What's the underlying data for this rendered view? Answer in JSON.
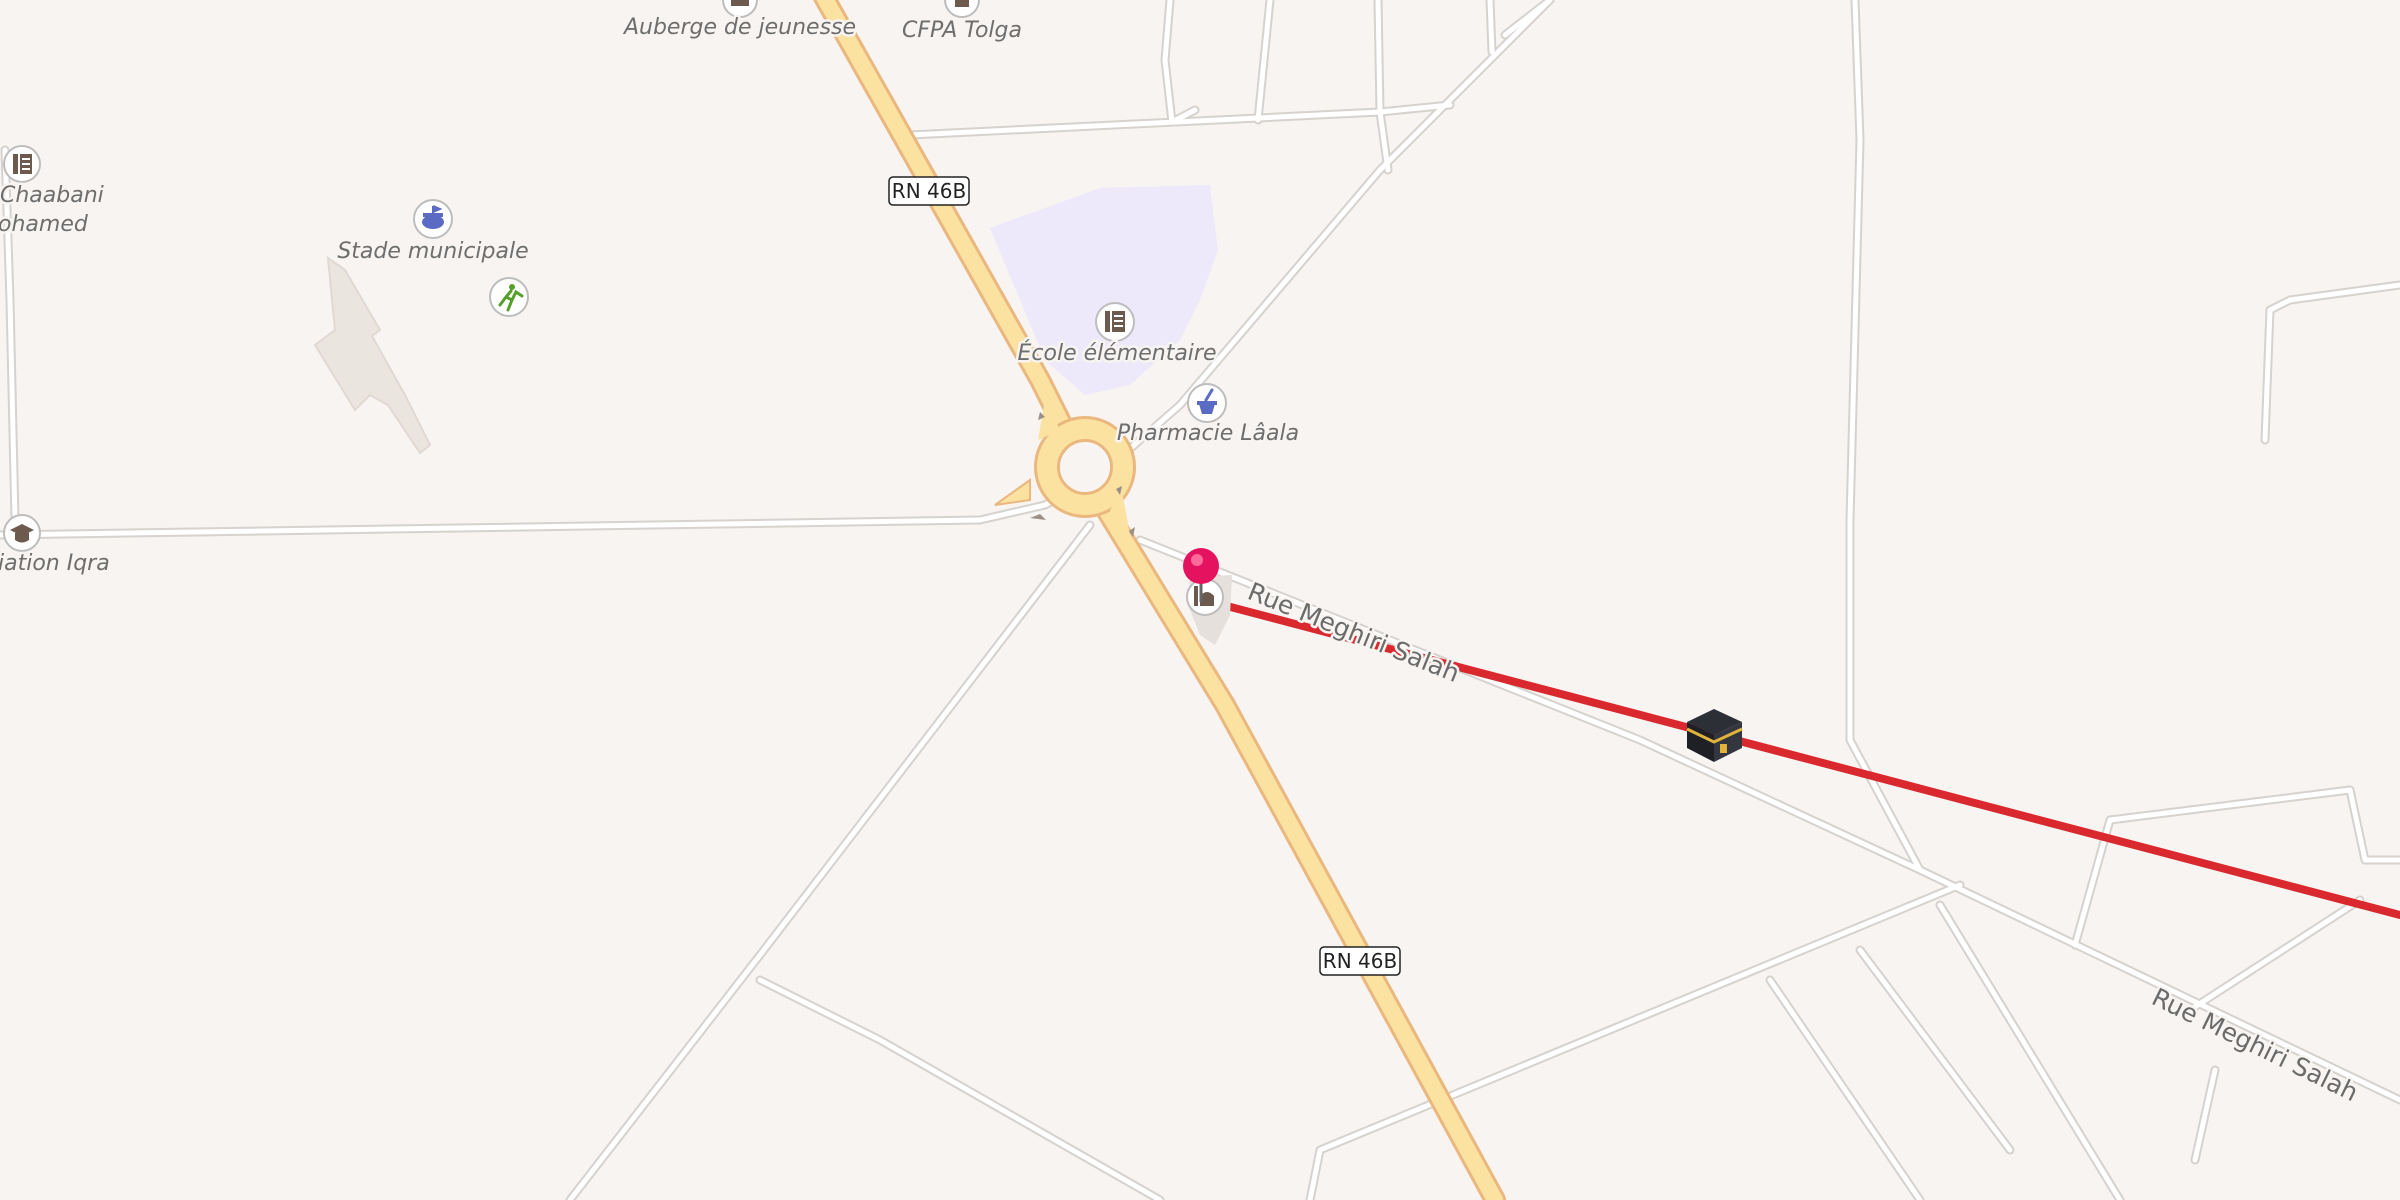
{
  "map": {
    "road_shields": {
      "north": "RN 46B",
      "south": "RN 46B"
    },
    "street_labels": {
      "rue_near": "Rue Meghiri Salah",
      "rue_far": "Rue Meghiri Salah"
    },
    "pois": {
      "auberge": {
        "label": "Auberge de jeunesse",
        "icon": "hostel-icon"
      },
      "cfpa": {
        "label": "CFPA Tolga",
        "icon": "training-center-icon"
      },
      "chaabani_line1": "Chaabani",
      "chaabani_line2": "ohamed",
      "stade": {
        "label": "Stade municipale",
        "icon": "stadium-icon"
      },
      "ecole": {
        "label": "École élémentaire",
        "icon": "school-icon"
      },
      "pharmacie": {
        "label": "Pharmacie Lâala",
        "icon": "pharmacy-icon"
      },
      "iqra": {
        "label": "iation Iqra",
        "icon": "graduation-cap-icon"
      }
    },
    "marker_color": "#e5135f",
    "route_color": "#d9292f",
    "icons": [
      "school-icon",
      "stadium-icon",
      "running-icon",
      "pharmacy-icon",
      "mosque-icon",
      "kaaba-icon",
      "location-pin-icon"
    ]
  }
}
